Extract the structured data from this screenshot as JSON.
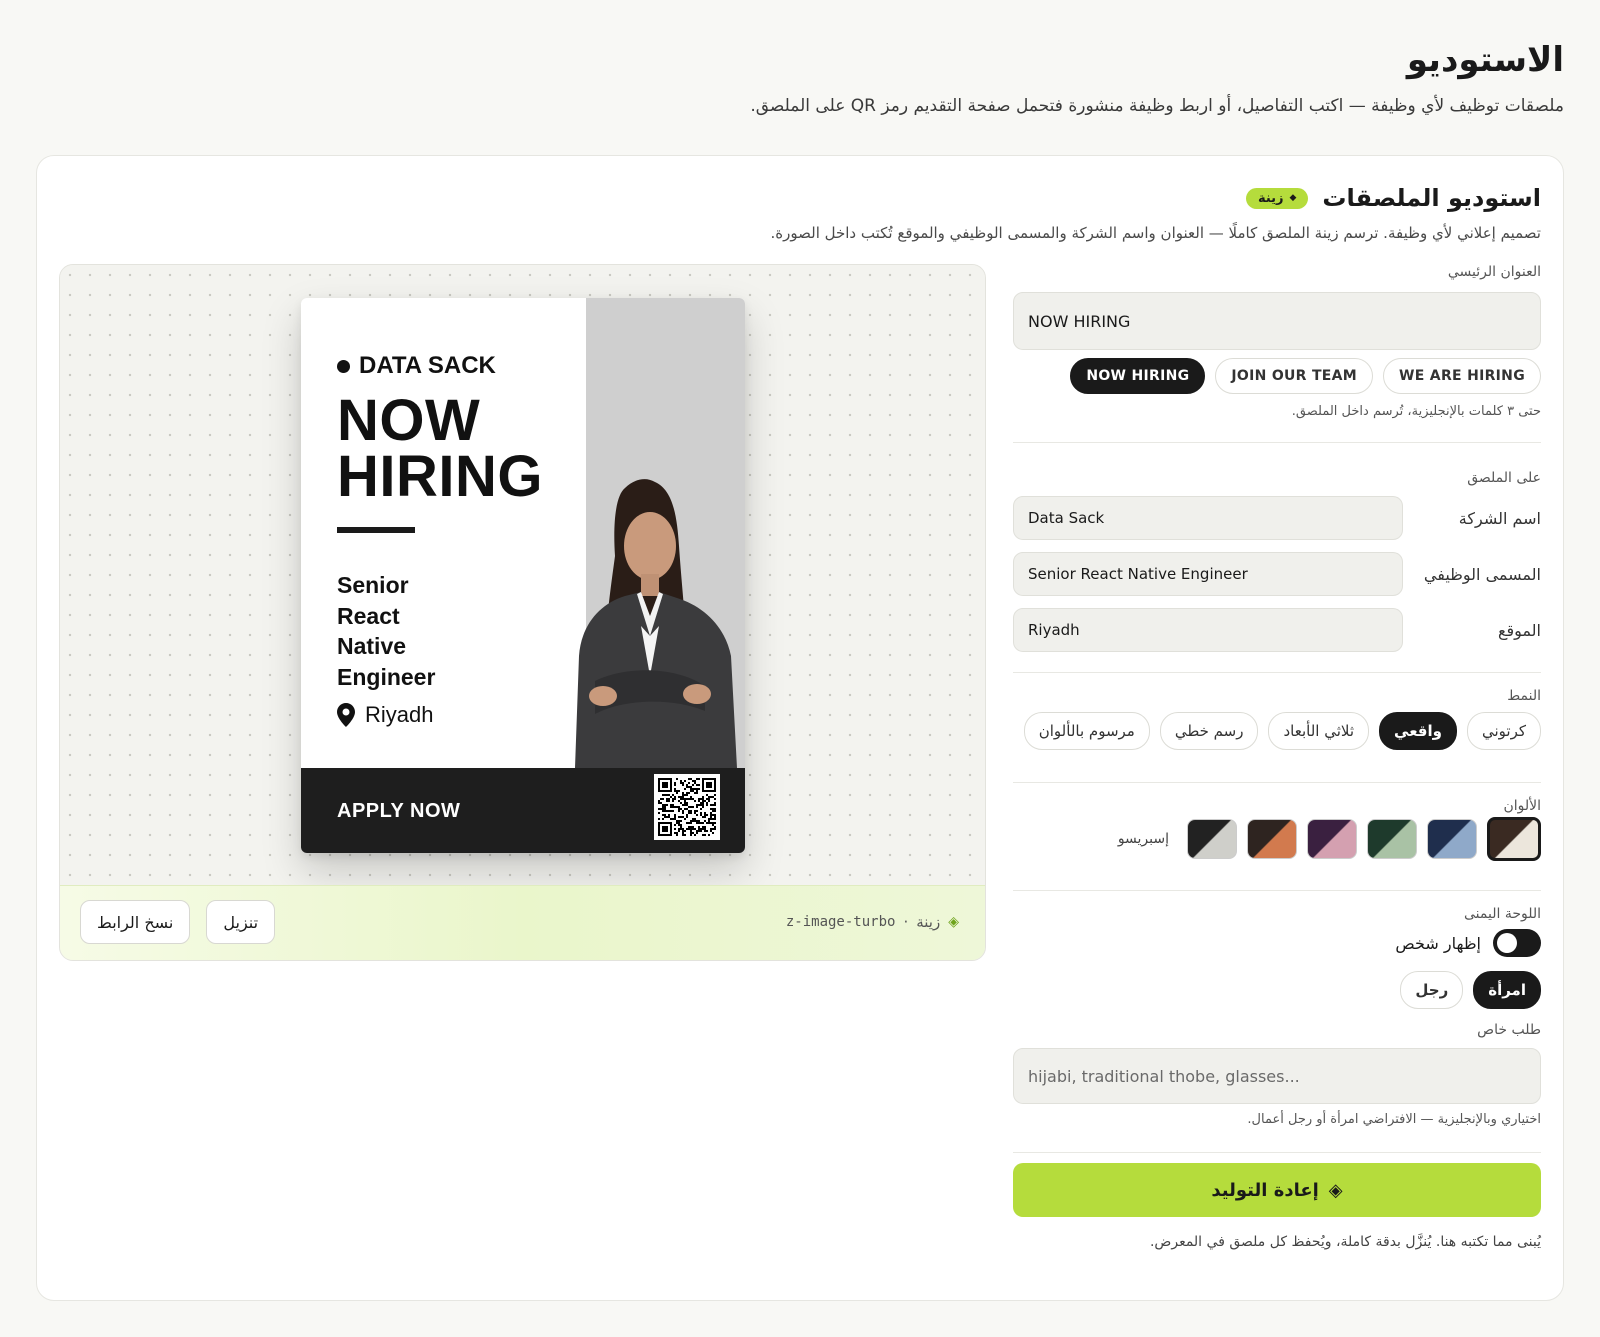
{
  "page": {
    "title": "الاستوديو",
    "subtitle": "ملصقات توظيف لأي وظيفة — اكتب التفاصيل، أو اربط وظيفة منشورة فتحمل صفحة التقديم رمز QR على الملصق."
  },
  "studio": {
    "title": "استوديو الملصقات",
    "badge": "زينة",
    "description": "تصميم إعلاني لأي وظيفة. ترسم زينة الملصق كاملًا — العنوان واسم الشركة والمسمى الوظيفي والموقع تُكتب داخل الصورة."
  },
  "headline": {
    "label": "العنوان الرئيسي",
    "value": "NOW HIRING",
    "presets": [
      "WE ARE HIRING",
      "JOIN OUR TEAM",
      "NOW HIRING"
    ],
    "active_preset": "NOW HIRING",
    "hint": "حتى ٣ كلمات بالإنجليزية، تُرسم داخل الملصق."
  },
  "on_poster": {
    "label": "على الملصق",
    "company_label": "اسم الشركة",
    "company_value": "Data Sack",
    "title_label": "المسمى الوظيفي",
    "title_value": "Senior React Native Engineer",
    "location_label": "الموقع",
    "location_value": "Riyadh"
  },
  "style": {
    "label": "النمط",
    "options": [
      "كرتوني",
      "واقعي",
      "ثلاثي الأبعاد",
      "رسم خطي",
      "مرسوم بالألوان"
    ],
    "active": "واقعي"
  },
  "colors": {
    "label": "الألوان",
    "active_name": "إسبريسو",
    "swatches": [
      {
        "a": "#3a2a22",
        "b": "#ece6dc",
        "active": true
      },
      {
        "a": "#1f2e4d",
        "b": "#8fa9c9"
      },
      {
        "a": "#1e3a2c",
        "b": "#a9c2a5"
      },
      {
        "a": "#3a2040",
        "b": "#d4a0b0"
      },
      {
        "a": "#2e2420",
        "b": "#d27a4e"
      },
      {
        "a": "#222222",
        "b": "#cfcfca"
      }
    ]
  },
  "right_panel": {
    "label": "اللوحة اليمنى",
    "toggle_label": "إظهار شخص",
    "genders": [
      "امرأة",
      "رجل"
    ],
    "active_gender": "امرأة"
  },
  "special": {
    "label": "طلب خاص",
    "placeholder": "hijabi, traditional thobe, glasses...",
    "hint": "اختياري وبالإنجليزية — الافتراضي امرأة أو رجل أعمال."
  },
  "actions": {
    "generate_label": "إعادة التوليد",
    "footer_note": "يُبنى مما تكتبه هنا. يُنزَّل بدقة كاملة، ويُحفظ كل ملصق في المعرض."
  },
  "preview": {
    "model_name": "زينة",
    "model_id": "z-image-turbo",
    "copy_link_label": "نسخ الرابط",
    "download_label": "تنزيل"
  },
  "poster": {
    "company": "DATA SACK",
    "headline_line1": "NOW",
    "headline_line2": "HIRING",
    "role_line1": "Senior",
    "role_line2": "React",
    "role_line3": "Native",
    "role_line4": "Engineer",
    "location": "Riyadh",
    "cta": "APPLY NOW"
  }
}
